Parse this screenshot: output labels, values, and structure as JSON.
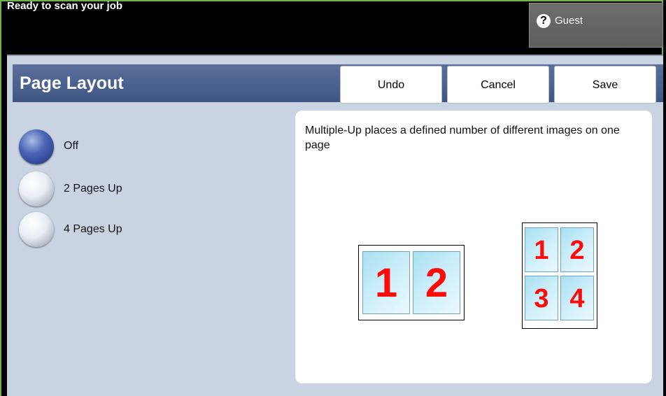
{
  "status_text": "Ready to scan your job",
  "user": {
    "label": "Guest",
    "icon": "help-icon"
  },
  "page": {
    "title": "Page Layout"
  },
  "toolbar": {
    "undo_label": "Undo",
    "cancel_label": "Cancel",
    "save_label": "Save"
  },
  "options": [
    {
      "label": "Off",
      "selected": true
    },
    {
      "label": "2 Pages Up",
      "selected": false
    },
    {
      "label": "4 Pages Up",
      "selected": false
    }
  ],
  "description": "Multiple-Up places a defined number of different images on one page",
  "illustration": {
    "two_up": [
      "1",
      "2"
    ],
    "four_up": [
      "1",
      "2",
      "3",
      "4"
    ]
  },
  "colors": {
    "accent": "#6fb34a",
    "title_bar": "#4a5f8c",
    "number_red": "#ff0a0a"
  }
}
